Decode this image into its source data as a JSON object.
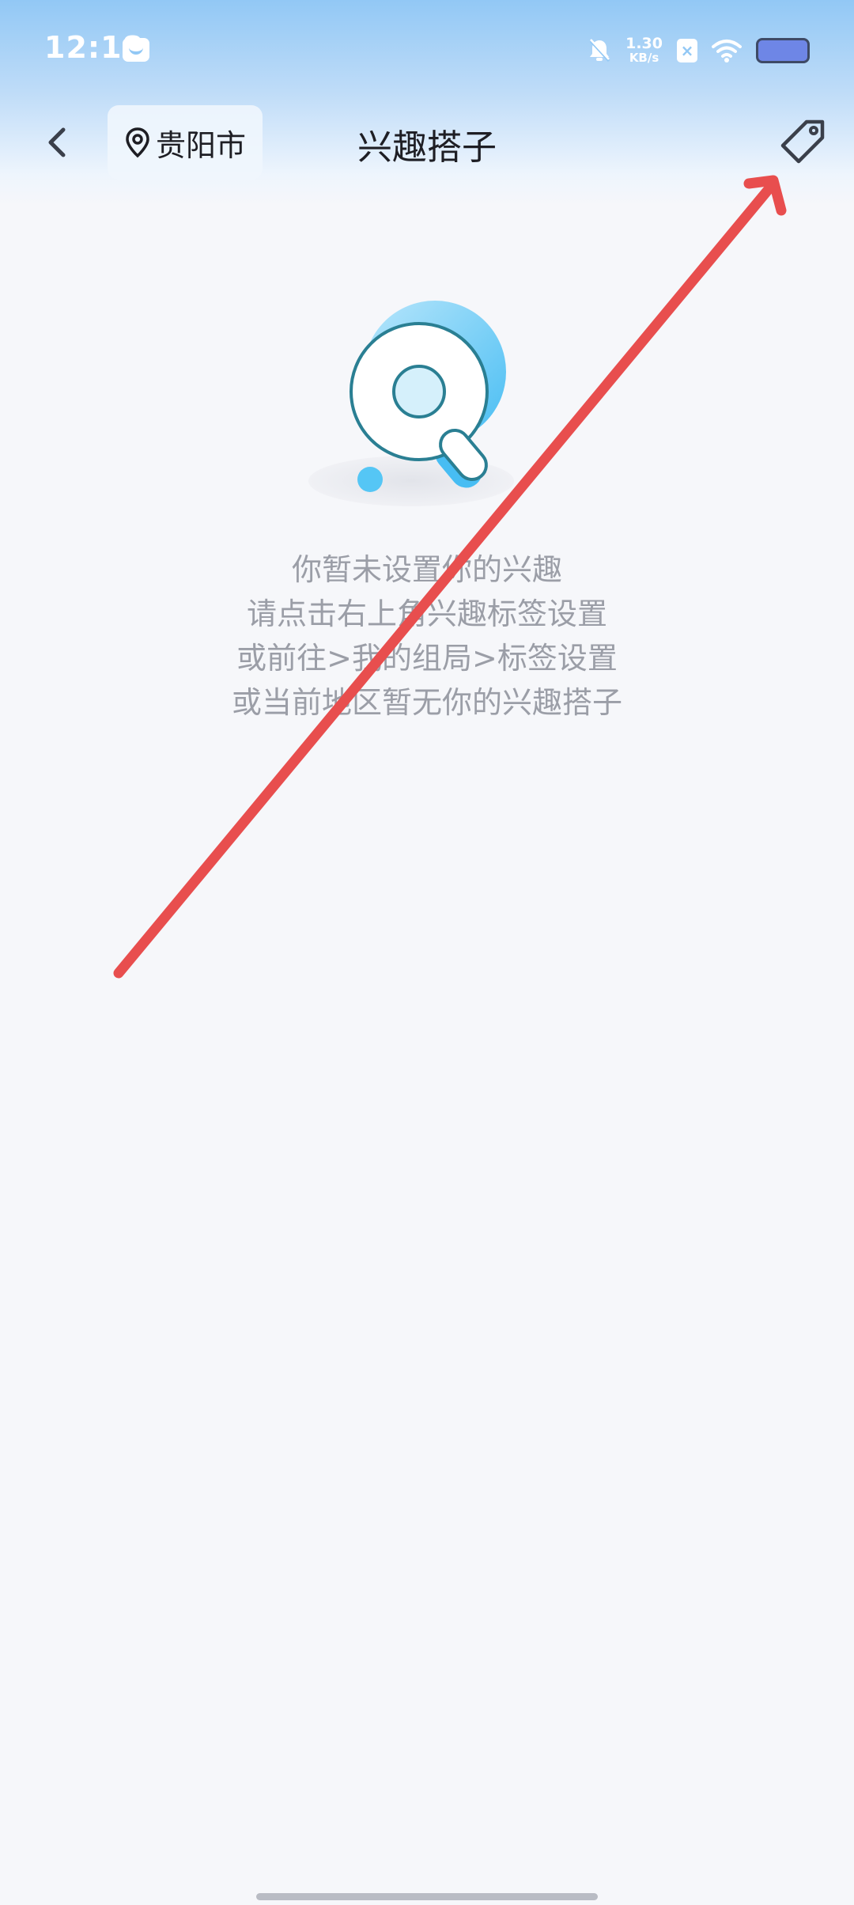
{
  "status_bar": {
    "time": "12:18",
    "net_speed_value": "1.30",
    "net_speed_unit": "KB/s",
    "sim_label": "×",
    "icons": [
      "app-notification-icon",
      "mute-icon",
      "sim-icon",
      "wifi-icon",
      "battery-icon"
    ]
  },
  "header": {
    "back_icon": "chevron-left-icon",
    "location_icon": "location-pin-icon",
    "location": "贵阳市",
    "title": "兴趣搭子",
    "tag_icon": "tag-icon"
  },
  "empty_state": {
    "illustration": "magnifier-search-illustration",
    "lines": [
      "你暂未设置你的兴趣",
      "请点击右上角兴趣标签设置",
      "或前往>我的组局>标签设置",
      "或当前地区暂无你的兴趣搭子"
    ]
  },
  "annotation": {
    "type": "arrow",
    "color": "#e84e4e"
  },
  "colors": {
    "accent": "#4fc3f7",
    "text_primary": "#1e1e24",
    "text_secondary": "#9b9ea7",
    "background": "#f6f7fa"
  }
}
